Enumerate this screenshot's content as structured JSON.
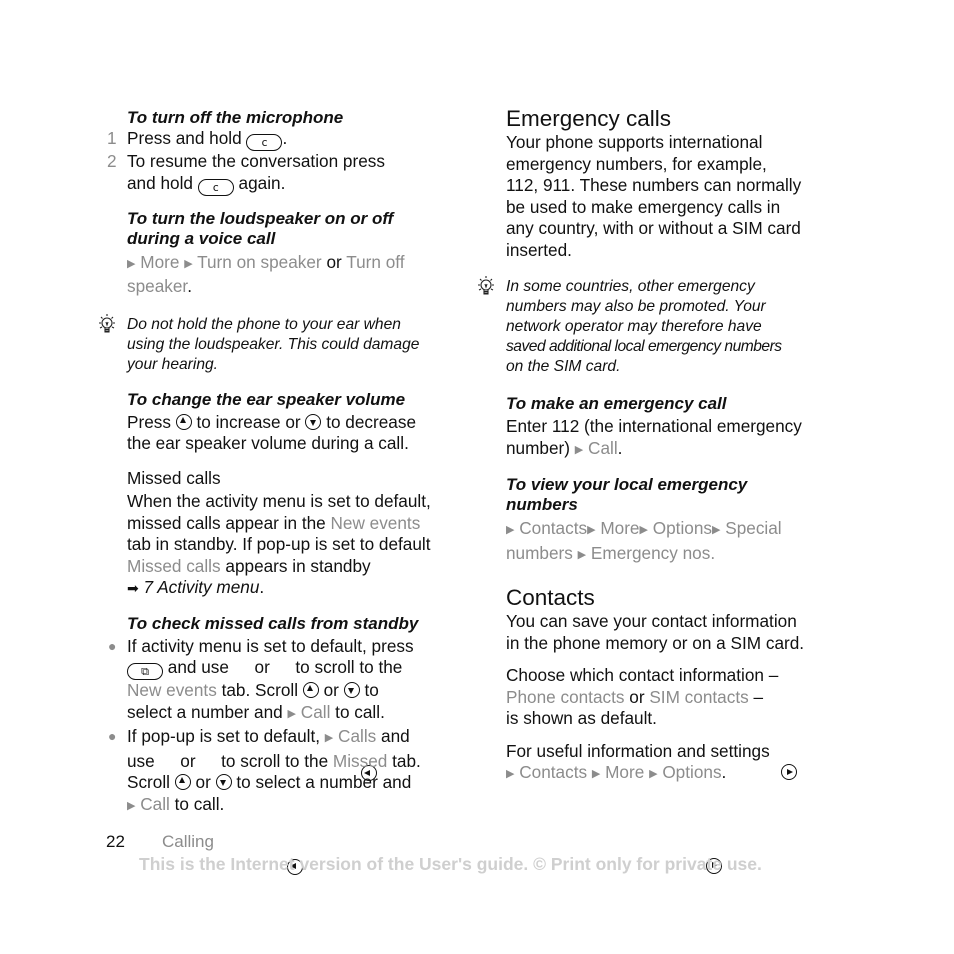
{
  "left": {
    "mic": {
      "title": "To turn off the microphone",
      "steps": [
        {
          "num": "1",
          "pre": "Press and hold",
          "key": "c",
          "post": "."
        },
        {
          "num": "2",
          "l1": "To resume the conversation press",
          "pre": "and hold",
          "key": "c",
          "post": "again."
        }
      ]
    },
    "speaker": {
      "title_l1": "To turn the loudspeaker on or off",
      "title_l2": "during a voice call",
      "path": {
        "more": "More",
        "on": "Turn on speaker",
        "or": "or",
        "off1": "Turn off",
        "off2": "speaker",
        "end": "."
      }
    },
    "tip": {
      "icon": "lightbulb-icon",
      "lines": [
        "Do not hold the phone to your ear when",
        "using the loudspeaker. This could damage",
        "your hearing."
      ]
    },
    "volume": {
      "title": "To change the ear speaker volume",
      "l1a": "Press",
      "l1b": "to increase or",
      "l1c": "to decrease",
      "l2": "the ear speaker volume during a call."
    },
    "missed": {
      "heading": "Missed calls",
      "l1": "When the activity menu is set to default,",
      "l2a": "missed calls appear in the",
      "l2b": "New events",
      "l3": "tab in standby. If pop-up is set to default",
      "l4a": "Missed calls",
      "l4b": "appears in standby",
      "l5": "7 Activity menu",
      "l5end": "."
    },
    "check": {
      "title": "To check missed calls from standby",
      "b1": {
        "l1": "If activity menu is set to default, press",
        "l2a": "and use",
        "l2b": "or",
        "l2c": "to scroll to the",
        "l3a": "New events",
        "l3b": "tab. Scroll",
        "l3c": "or",
        "l3d": "to",
        "l4a": "select a number and",
        "l4b": "Call",
        "l4c": "to call."
      },
      "b2": {
        "l1a": "If pop-up is set to default,",
        "l1b": "Calls",
        "l1c": "and",
        "l2a": "use",
        "l2b": "or",
        "l2c": "to scroll to the",
        "l2d": "Missed",
        "l2e": "tab.",
        "l3a": "Scroll",
        "l3b": "or",
        "l3c": "to select a number and",
        "l4a": "Call",
        "l4b": "to call."
      }
    }
  },
  "right": {
    "emergency": {
      "heading": "Emergency calls",
      "lines": [
        "Your phone supports international",
        "emergency numbers, for example,",
        "112, 911. These numbers can normally",
        "be used to make emergency calls in",
        "any country, with or without a SIM card",
        "inserted."
      ]
    },
    "tip": {
      "icon": "lightbulb-icon",
      "lines": [
        "In some countries, other emergency",
        "numbers may also be promoted. Your",
        "network operator may therefore have",
        "saved additional local emergency numbers",
        "on the SIM card."
      ]
    },
    "make": {
      "title": "To make an emergency call",
      "l1": "Enter 112 (the international emergency",
      "l2a": "number)",
      "l2b": "Call",
      "l2c": "."
    },
    "view": {
      "title_l1": "To view your local emergency",
      "title_l2": "numbers",
      "path": [
        "Contacts",
        "More",
        "Options",
        "Special",
        "numbers",
        "Emergency nos."
      ]
    },
    "contacts": {
      "heading": "Contacts",
      "p1": [
        "You can save your contact information",
        "in the phone memory or on a SIM card."
      ],
      "p2a": "Choose which contact information –",
      "p2b": "Phone contacts",
      "p2c": "or",
      "p2d": "SIM contacts",
      "p2e": "–",
      "p2f": "is shown as default.",
      "p3": "For useful information and settings",
      "p3path": [
        "Contacts",
        "More",
        "Options"
      ],
      "p3end": "."
    }
  },
  "footer": {
    "page": "22",
    "section": "Calling",
    "notice": "This is the Internet version of the User's guide. © Print only for private use."
  }
}
